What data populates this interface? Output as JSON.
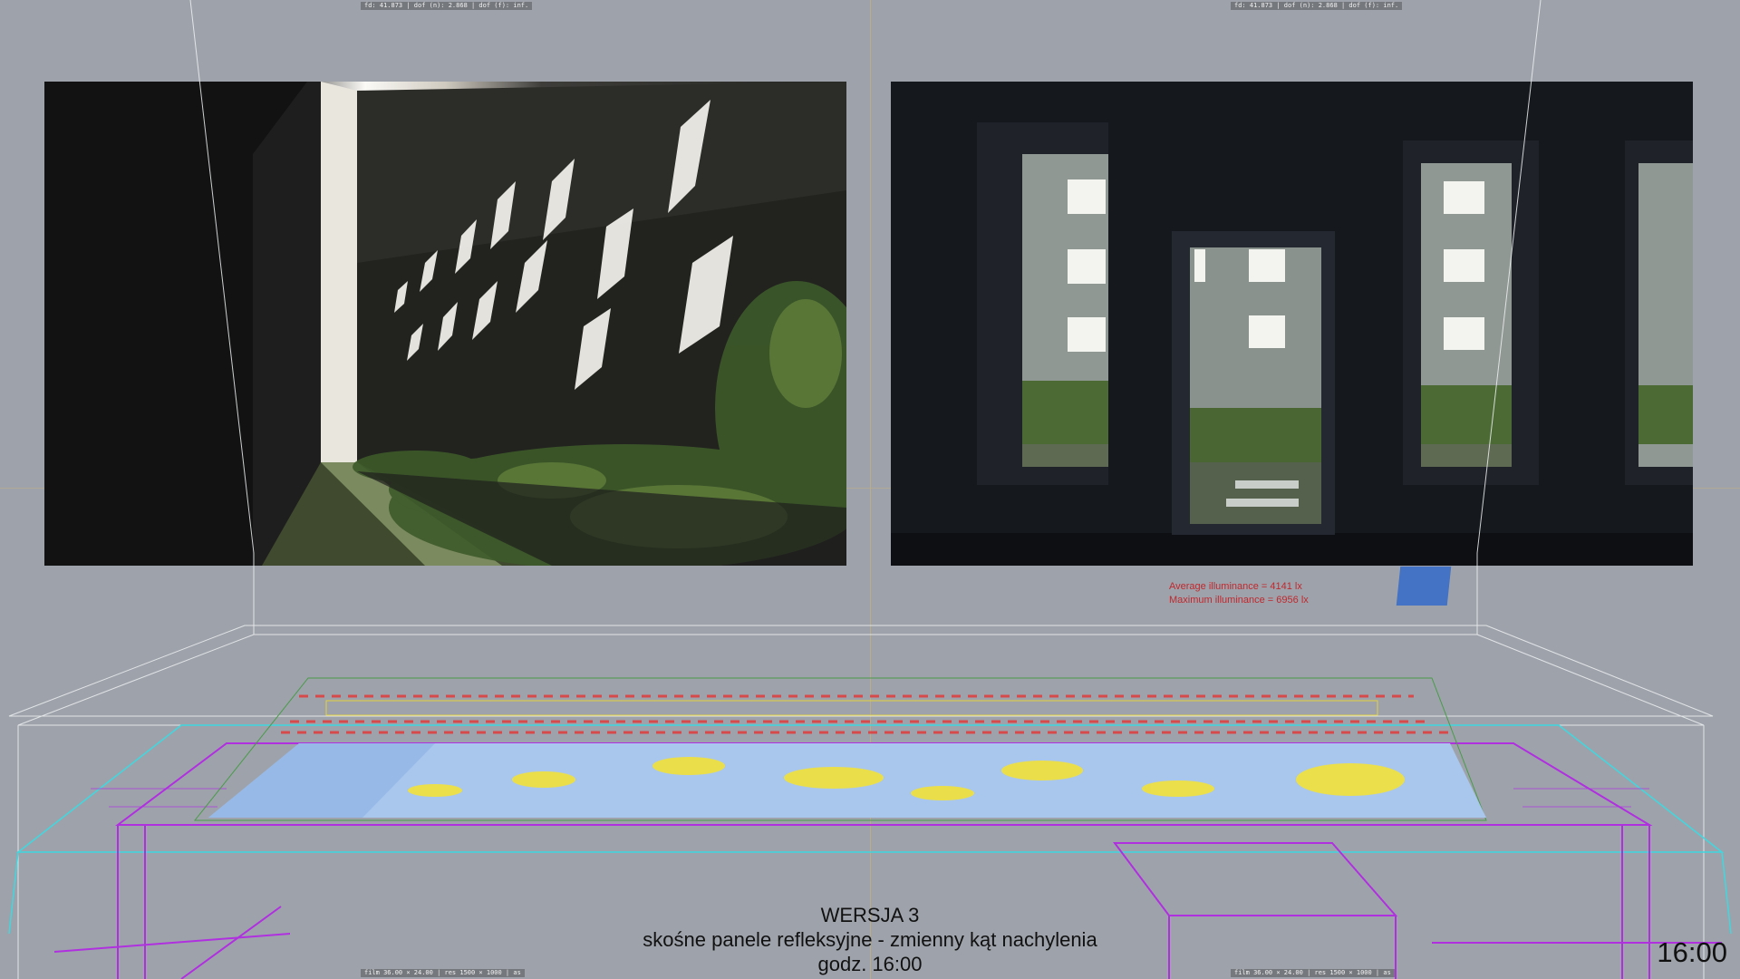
{
  "camera_hud": {
    "top_left": "fd: 41.873  |  dof (n): 2.868  |  dof (f): inf.",
    "top_right": "fd: 41.873  |  dof (n): 2.868  |  dof (f): inf.",
    "bottom_left": "film 36.00 × 24.00  |  res 1500 × 1000  |  as",
    "bottom_right": "film 36.00 × 24.00  |  res 1500 × 1000  |  as"
  },
  "illuminance": {
    "average": "Average illuminance = 4141 lx",
    "maximum": "Maximum illuminance = 6956 lx"
  },
  "caption": {
    "title": "WERSJA 3",
    "subtitle": "skośne panele refleksyjne - zmienny kąt nachylenia",
    "time_label": "godz. 16:00"
  },
  "clock": "16:00",
  "icons": {
    "illuminance_grid": "illuminance-grid-icon",
    "sensor_swatch": "sensor-swatch-icon"
  },
  "colors": {
    "background": "#9ea3ab",
    "wireframe_magenta": "#b030e0",
    "wireframe_cyan": "#3fd8e0",
    "heatmap_low": "#a9c6ec",
    "heatmap_high": "#f2e23a",
    "metric_text": "#c0272d",
    "swatch": "#4472c4"
  }
}
